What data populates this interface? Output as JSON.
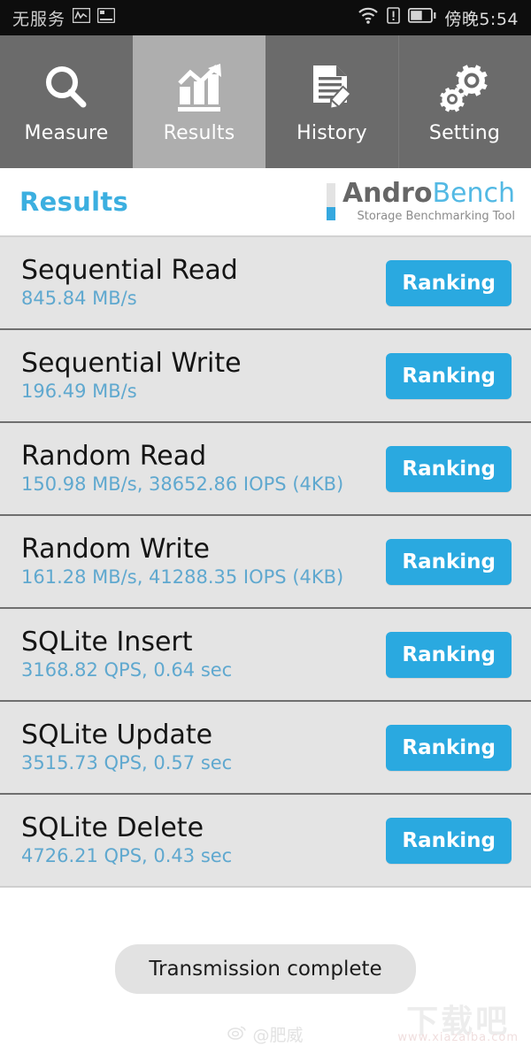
{
  "status_bar": {
    "carrier": "无服务",
    "icons_left": [
      "signal-chart-icon",
      "screenshot-icon"
    ],
    "icons_right": [
      "wifi-icon",
      "alert-icon",
      "battery-icon"
    ],
    "time": "傍晚5:54"
  },
  "tabs": [
    {
      "label": "Measure",
      "icon": "magnifier-icon",
      "active": false
    },
    {
      "label": "Results",
      "icon": "bar-chart-arrow-icon",
      "active": true
    },
    {
      "label": "History",
      "icon": "document-pencil-icon",
      "active": false
    },
    {
      "label": "Setting",
      "icon": "gears-icon",
      "active": false
    }
  ],
  "header": {
    "title": "Results",
    "brand_first": "Andro",
    "brand_second": "Bench",
    "brand_tagline": "Storage Benchmarking Tool"
  },
  "results": [
    {
      "title": "Sequential Read",
      "value": "845.84 MB/s",
      "button": "Ranking"
    },
    {
      "title": "Sequential Write",
      "value": "196.49 MB/s",
      "button": "Ranking"
    },
    {
      "title": "Random Read",
      "value": "150.98 MB/s, 38652.86 IOPS (4KB)",
      "button": "Ranking"
    },
    {
      "title": "Random Write",
      "value": "161.28 MB/s, 41288.35 IOPS (4KB)",
      "button": "Ranking"
    },
    {
      "title": "SQLite Insert",
      "value": "3168.82 QPS, 0.64 sec",
      "button": "Ranking"
    },
    {
      "title": "SQLite Update",
      "value": "3515.73 QPS, 0.57 sec",
      "button": "Ranking"
    },
    {
      "title": "SQLite Delete",
      "value": "4726.21 QPS, 0.43 sec",
      "button": "Ranking"
    }
  ],
  "toast": {
    "message": "Transmission complete"
  },
  "watermarks": {
    "weibo": "@肥威",
    "site_name": "下载吧",
    "site_url": "www.xiazaiba.com"
  },
  "colors": {
    "accent_blue": "#2aa9e0",
    "value_blue": "#5fa8cf",
    "title_blue": "#3cafe0",
    "tab_bg": "#6b6b6b",
    "tab_active_bg": "#aeaeae",
    "row_bg": "#e4e4e4"
  }
}
